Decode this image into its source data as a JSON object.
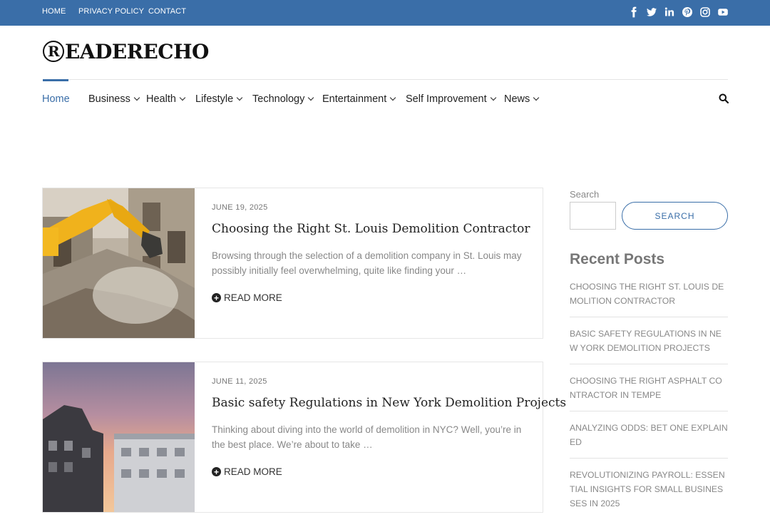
{
  "topbar": {
    "links": [
      "HOME",
      "PRIVACY POLICY",
      "CONTACT"
    ],
    "social_icons": [
      "facebook-icon",
      "twitter-icon",
      "linkedin-icon",
      "pinterest-icon",
      "instagram-icon",
      "youtube-icon"
    ]
  },
  "site": {
    "logo_text": "EADERECHO",
    "logo_mark": "R"
  },
  "nav": {
    "items": [
      "Home",
      "Business",
      "Health",
      "Lifestyle",
      "Technology",
      "Entertainment",
      "Self Improvement",
      "News"
    ],
    "active": "Home"
  },
  "posts": [
    {
      "date": "JUNE 19, 2025",
      "title": "Choosing the Right St. Louis Demolition Contractor",
      "excerpt": "Browsing through the selection of a demolition company in St. Louis may possibly initially feel overwhelming, quite like finding your …",
      "read_more": "READ MORE"
    },
    {
      "date": "JUNE 11, 2025",
      "title": "Basic safety Regulations in New York Demolition Projects",
      "excerpt": "Thinking about diving into the world of demolition in NYC? Well, you’re in the best place. We’re about to take …",
      "read_more": "READ MORE"
    }
  ],
  "sidebar": {
    "search_label": "Search",
    "search_placeholder": "",
    "search_button": "SEARCH",
    "recent_heading": "Recent Posts",
    "recent_posts": [
      "CHOOSING THE RIGHT ST. LOUIS DEMOLITION CONTRACTOR",
      "BASIC SAFETY REGULATIONS IN NEW YORK DEMOLITION PROJECTS",
      "CHOOSING THE RIGHT ASPHALT CONTRACTOR IN TEMPE",
      "ANALYZING ODDS: BET ONE EXPLAINED",
      "REVOLUTIONIZING PAYROLL: ESSENTIAL INSIGHTS FOR SMALL BUSINESSES IN 2025"
    ]
  },
  "colors": {
    "accent": "#3a6ea8",
    "text": "#222222",
    "muted": "#888888"
  }
}
